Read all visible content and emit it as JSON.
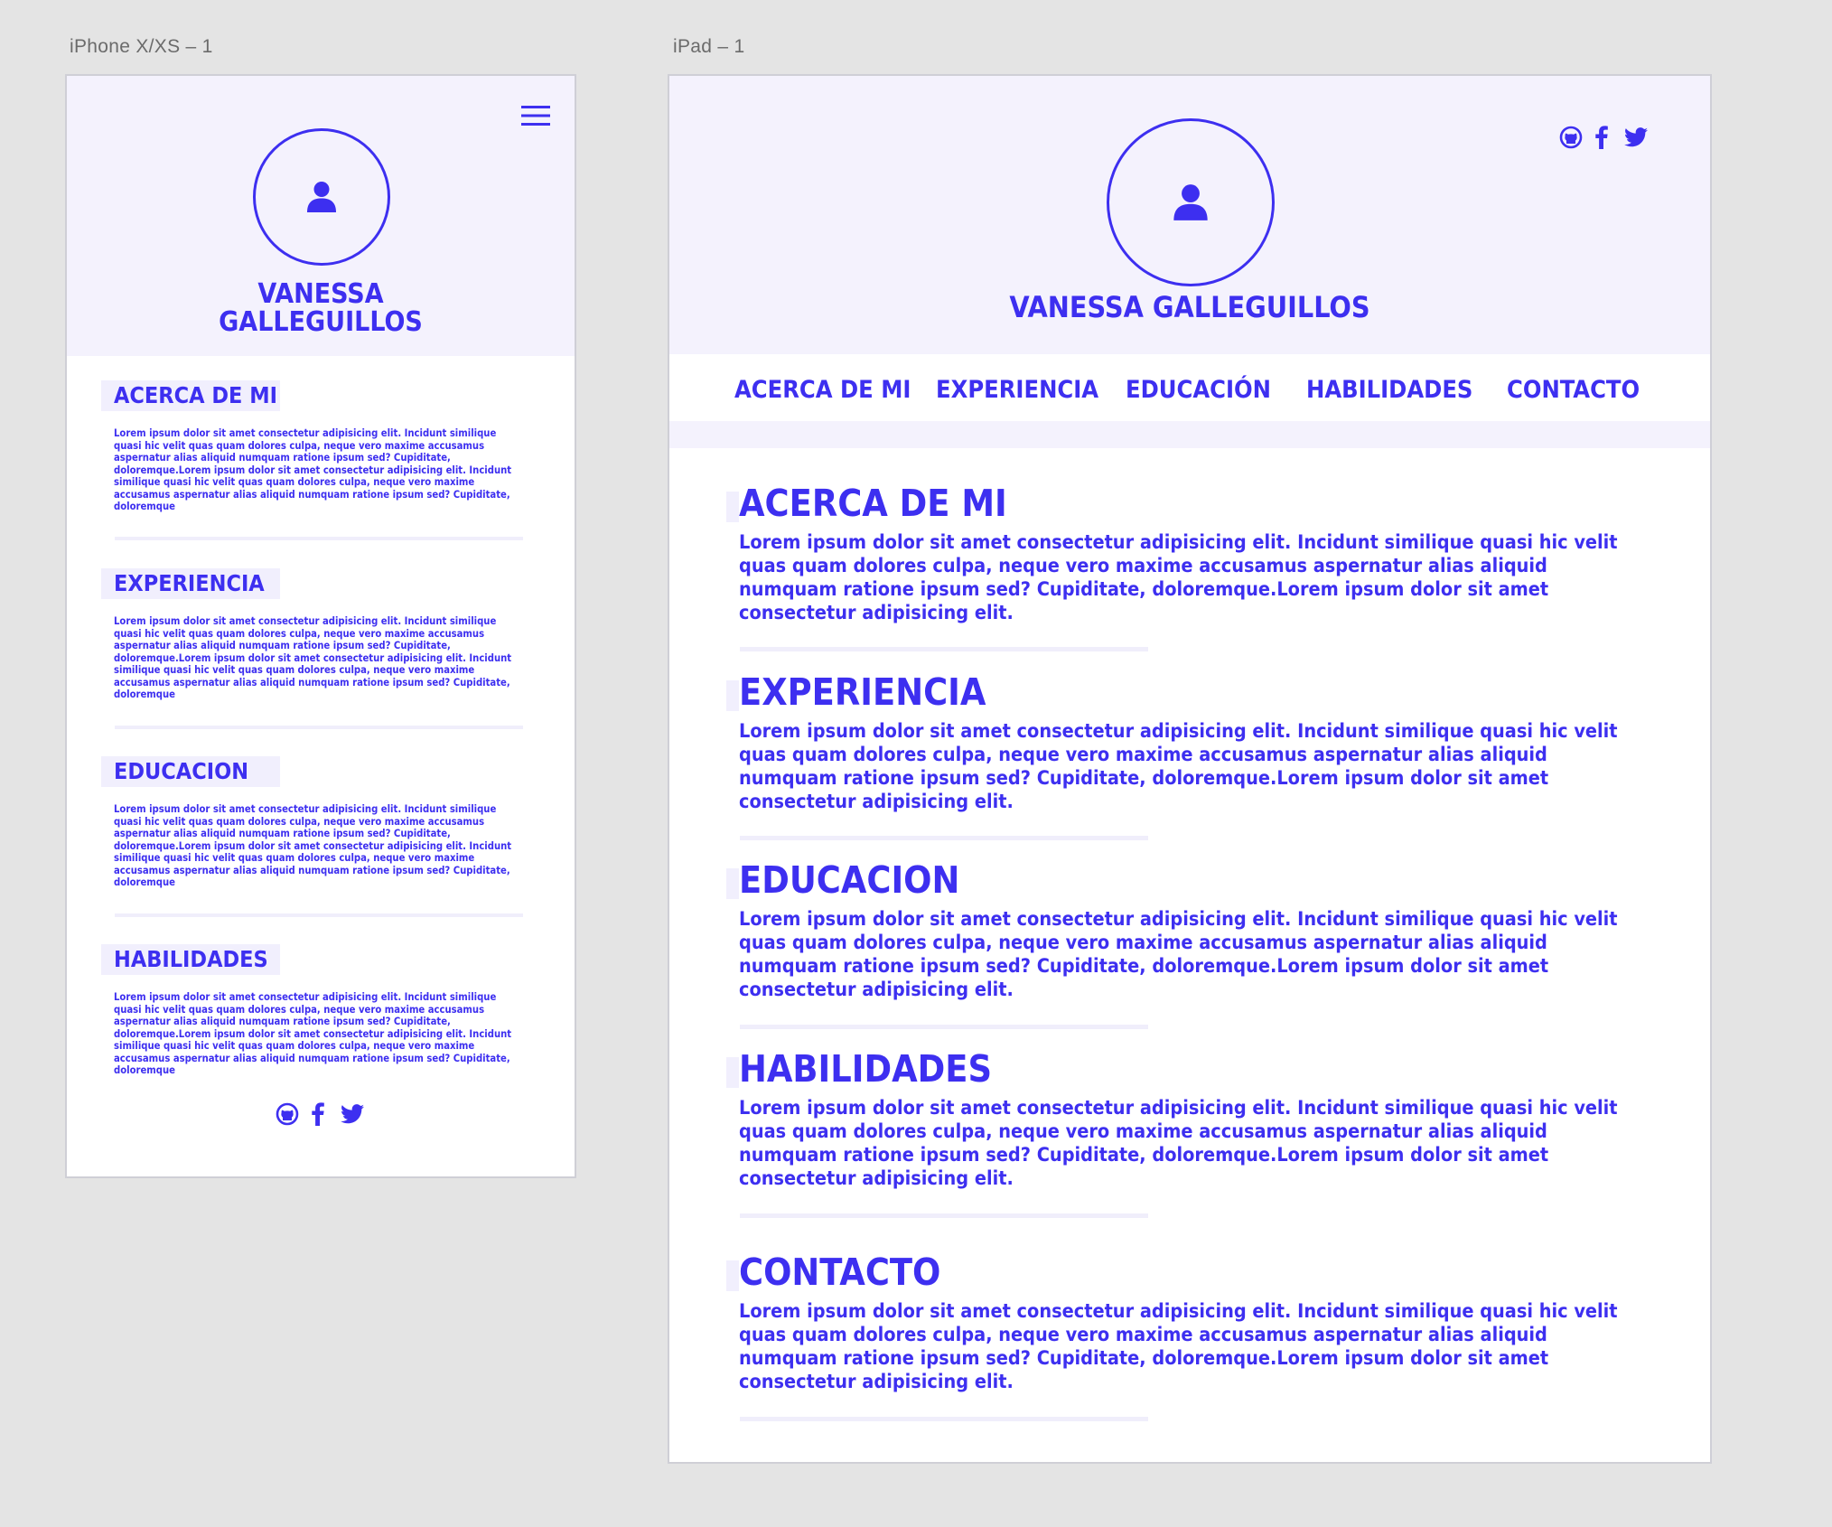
{
  "artboards": {
    "phone_label": "iPhone X/XS – 1",
    "tablet_label": "iPad – 1"
  },
  "colors": {
    "accent": "#3d2ff0",
    "hero_bg": "#f4f2fd",
    "canvas": "#e4e4e4"
  },
  "profile": {
    "name_phone_line1": "VANESSA",
    "name_phone_line2": "GALLEGUILLOS",
    "name_full": "VANESSA GALLEGUILLOS",
    "avatar_icon": "user-icon"
  },
  "social": [
    "github-icon",
    "facebook-icon",
    "twitter-icon"
  ],
  "nav": [
    {
      "label": "ACERCA DE MI"
    },
    {
      "label": "EXPERIENCIA"
    },
    {
      "label": "EDUCACIÓN"
    },
    {
      "label": "HABILIDADES"
    },
    {
      "label": "CONTACTO"
    }
  ],
  "phone_sections": [
    {
      "title": "ACERCA DE MI",
      "text": "Lorem ipsum dolor sit amet consectetur adipisicing elit. Incidunt similique quasi hic velit quas quam dolores culpa, neque vero maxime accusamus aspernatur alias aliquid numquam ratione ipsum sed? Cupiditate, doloremque.Lorem ipsum dolor sit amet consectetur adipisicing elit. Incidunt similique quasi hic velit quas quam dolores culpa, neque vero maxime accusamus aspernatur alias aliquid numquam ratione ipsum sed? Cupiditate, doloremque"
    },
    {
      "title": "EXPERIENCIA",
      "text": "Lorem ipsum dolor sit amet consectetur adipisicing elit. Incidunt similique quasi hic velit quas quam dolores culpa, neque vero maxime accusamus aspernatur alias aliquid numquam ratione ipsum sed? Cupiditate, doloremque.Lorem ipsum dolor sit amet consectetur adipisicing elit. Incidunt similique quasi hic velit quas quam dolores culpa, neque vero maxime accusamus aspernatur alias aliquid numquam ratione ipsum sed? Cupiditate, doloremque"
    },
    {
      "title": "EDUCACION",
      "text": "Lorem ipsum dolor sit amet consectetur adipisicing elit. Incidunt similique quasi hic velit quas quam dolores culpa, neque vero maxime accusamus aspernatur alias aliquid numquam ratione ipsum sed? Cupiditate, doloremque.Lorem ipsum dolor sit amet consectetur adipisicing elit. Incidunt similique quasi hic velit quas quam dolores culpa, neque vero maxime accusamus aspernatur alias aliquid numquam ratione ipsum sed? Cupiditate, doloremque"
    },
    {
      "title": "HABILIDADES",
      "text": "Lorem ipsum dolor sit amet consectetur adipisicing elit. Incidunt similique quasi hic velit quas quam dolores culpa, neque vero maxime accusamus aspernatur alias aliquid numquam ratione ipsum sed? Cupiditate, doloremque.Lorem ipsum dolor sit amet consectetur adipisicing elit. Incidunt similique quasi hic velit quas quam dolores culpa, neque vero maxime accusamus aspernatur alias aliquid numquam ratione ipsum sed? Cupiditate, doloremque"
    }
  ],
  "tablet_sections": [
    {
      "title": "ACERCA DE MI",
      "text": "Lorem ipsum dolor sit amet consectetur adipisicing elit. Incidunt similique quasi hic velit quas quam dolores culpa, neque vero maxime accusamus aspernatur alias aliquid numquam ratione ipsum sed? Cupiditate, doloremque.Lorem ipsum dolor sit amet consectetur adipisicing elit."
    },
    {
      "title": "EXPERIENCIA",
      "text": "Lorem ipsum dolor sit amet consectetur adipisicing elit. Incidunt similique quasi hic velit quas quam dolores culpa, neque vero maxime accusamus aspernatur alias aliquid numquam ratione ipsum sed? Cupiditate, doloremque.Lorem ipsum dolor sit amet consectetur adipisicing elit."
    },
    {
      "title": "EDUCACION",
      "text": "Lorem ipsum dolor sit amet consectetur adipisicing elit. Incidunt similique quasi hic velit quas quam dolores culpa, neque vero maxime accusamus aspernatur alias aliquid numquam ratione ipsum sed? Cupiditate, doloremque.Lorem ipsum dolor sit amet consectetur adipisicing elit."
    },
    {
      "title": "HABILIDADES",
      "text": "Lorem ipsum dolor sit amet consectetur adipisicing elit. Incidunt similique quasi hic velit quas quam dolores culpa, neque vero maxime accusamus aspernatur alias aliquid numquam ratione ipsum sed? Cupiditate, doloremque.Lorem ipsum dolor sit amet consectetur adipisicing elit."
    },
    {
      "title": "CONTACTO",
      "text": "Lorem ipsum dolor sit amet consectetur adipisicing elit. Incidunt similique quasi hic velit quas quam dolores culpa, neque vero maxime accusamus aspernatur alias aliquid numquam ratione ipsum sed? Cupiditate, doloremque.Lorem ipsum dolor sit amet consectetur adipisicing elit."
    }
  ]
}
